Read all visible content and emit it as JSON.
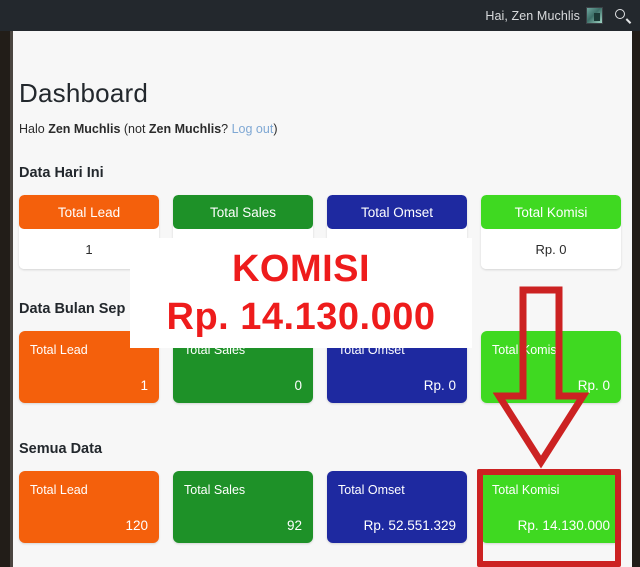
{
  "adminbar": {
    "greeting": "Hai, Zen Muchlis",
    "avatar_icon": "user-avatar-thumbnail",
    "search_icon": "search-icon"
  },
  "page": {
    "title": "Dashboard",
    "halo_prefix": "Halo ",
    "halo_user": "Zen Muchlis",
    "halo_mid": " (not ",
    "halo_user2": "Zen Muchlis",
    "halo_q": "? ",
    "logout_label": "Log out",
    "halo_suffix": ")"
  },
  "sections": {
    "hari": "Data Hari Ini",
    "bulan": "Data Bulan Sep",
    "semua": "Semua Data"
  },
  "colors": {
    "orange": "#f4600c",
    "green": "#1e9128",
    "blue": "#1e29a0",
    "lime": "#3fd921",
    "annotation_red": "#cc2222",
    "overlay_red": "#ee1c1c",
    "adminbar": "#23282d"
  },
  "cards_hari": [
    {
      "label": "Total Lead",
      "value": "1"
    },
    {
      "label": "Total Sales",
      "value": ""
    },
    {
      "label": "Total Omset",
      "value": ""
    },
    {
      "label": "Total Komisi",
      "value": "Rp. 0"
    }
  ],
  "cards_bulan": [
    {
      "label": "Total Lead",
      "value": "1"
    },
    {
      "label": "Total Sales",
      "value": "0"
    },
    {
      "label": "Total Omset",
      "value": "Rp. 0"
    },
    {
      "label": "Total Komisi",
      "value": "Rp. 0"
    }
  ],
  "cards_semua": [
    {
      "label": "Total Lead",
      "value": "120"
    },
    {
      "label": "Total Sales",
      "value": "92"
    },
    {
      "label": "Total Omset",
      "value": "Rp. 52.551.329"
    },
    {
      "label": "Total Komisi",
      "value": "Rp. 14.130.000"
    }
  ],
  "annotation": {
    "overlay_line1": "KOMISI",
    "overlay_line2": "Rp. 14.130.000",
    "arrow_icon": "down-arrow-annotation",
    "highlight_icon": "highlight-box-annotation"
  }
}
